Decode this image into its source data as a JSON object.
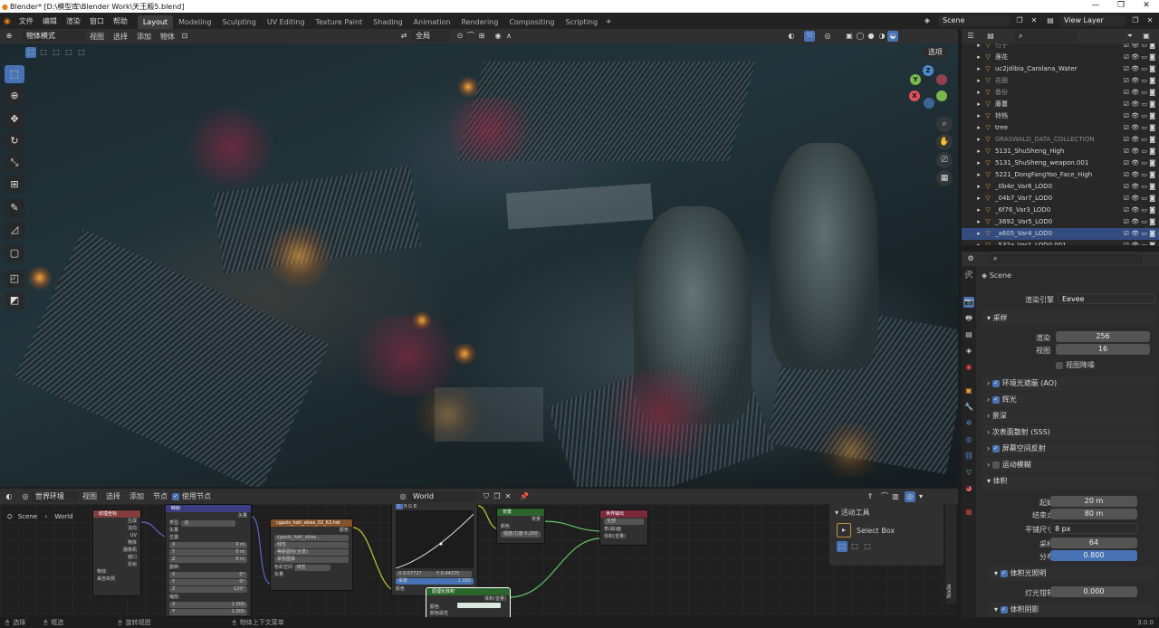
{
  "window": {
    "title": "Blender* [D:\\模型库\\Blender Work\\天王殿5.blend]",
    "minimize": "—",
    "restore": "❐",
    "close": "✕"
  },
  "menu": [
    "文件",
    "编辑",
    "渲染",
    "窗口",
    "帮助"
  ],
  "workspaces": [
    "Layout",
    "Modeling",
    "Sculpting",
    "UV Editing",
    "Texture Paint",
    "Shading",
    "Animation",
    "Rendering",
    "Compositing",
    "Scripting"
  ],
  "active_workspace": "Layout",
  "scene": {
    "name": "Scene",
    "view_layer": "View Layer"
  },
  "viewport_header": {
    "mode": "物体模式",
    "menus": [
      "视图",
      "选择",
      "添加",
      "物体"
    ],
    "transform": "全局",
    "options": "选项"
  },
  "toolbar": [
    "select-box",
    "cursor",
    "move",
    "rotate",
    "scale",
    "transform",
    "annotate",
    "measure",
    "add-cube"
  ],
  "gizmo": {
    "z": "Z",
    "y": "Y",
    "x": "X"
  },
  "node_header": {
    "type": "世界环境",
    "menus": [
      "视图",
      "选择",
      "添加",
      "节点"
    ],
    "use_nodes": "使用节点",
    "world": "World"
  },
  "node_breadcrumb": {
    "scene": "Scene",
    "world": "World"
  },
  "nodes": {
    "texcoord": {
      "title": "纹理坐标",
      "outputs": [
        "生成",
        "法向",
        "UV",
        "物体",
        "摄像机",
        "窗口",
        "反射"
      ],
      "object_label": "物体:",
      "from_instancer": "来自实例"
    },
    "mapping": {
      "title": "映射",
      "output": "矢量",
      "type_label": "类型:",
      "type_value": "点",
      "vector": "矢量",
      "location": "位置:",
      "x": "X",
      "y": "Y",
      "z": "Z",
      "loc_x": "0 m",
      "loc_y": "0 m",
      "loc_z": "0 m",
      "rotation": "旋转:",
      "rot_x": "0°",
      "rot_y": "0°",
      "rot_z": "120°",
      "scale": "缩放:",
      "sc_x": "1.000",
      "sc_y": "1.000"
    },
    "envtex": {
      "title": "cgaxis_hdri_skies_02_63.hdr",
      "output": "颜色",
      "image": "cgaxis_hdri_skies...",
      "interp": "线性",
      "proj": "等距圆柱(全景)",
      "ext": "单张图像",
      "colorspace_label": "色彩空间",
      "colorspace": "线性",
      "vector": "矢量"
    },
    "curves": {
      "x": "X 0.57727",
      "y": "Y 0.44375",
      "factor": "系数",
      "factor_val": "1.000",
      "color": "颜色"
    },
    "background": {
      "title": "背景",
      "output": "背景",
      "color": "颜色",
      "strength": "强度/力度",
      "strength_val": "0.200"
    },
    "world_output": {
      "title": "世界输出",
      "target": "全部",
      "surface": "表(曲)面",
      "volume": "体积(音量)"
    },
    "volume": {
      "title": "原理化体积",
      "output": "体积(音量)",
      "color": "颜色",
      "density": "颜色属性"
    }
  },
  "tool_panel": {
    "title": "活动工具",
    "tool": "Select Box",
    "tab": "Node"
  },
  "outliner": [
    {
      "name": "竹子",
      "dim": true
    },
    {
      "name": "莲花",
      "dim": false
    },
    {
      "name": "uc2jdibia_Carolana_Water",
      "dim": false
    },
    {
      "name": "花圈",
      "dim": true
    },
    {
      "name": "备份",
      "dim": true
    },
    {
      "name": "藤蔓",
      "dim": false
    },
    {
      "name": "铃铛",
      "dim": false
    },
    {
      "name": "tree",
      "dim": false
    },
    {
      "name": "GRASWALD_DATA_COLLECTION",
      "dim": true
    },
    {
      "name": "5131_ShuSheng_High",
      "dim": false
    },
    {
      "name": "5131_ShuSheng_weapon.001",
      "dim": false
    },
    {
      "name": "5221_DongFangYao_Face_High",
      "dim": false
    },
    {
      "name": "_0b4e_Var6_LOD0",
      "dim": false
    },
    {
      "name": "_04b7_Var7_LOD0",
      "dim": false
    },
    {
      "name": "_6f76_Var3_LOD0",
      "dim": false
    },
    {
      "name": "_3692_Var5_LOD0",
      "dim": false
    },
    {
      "name": "_a605_Var4_LOD0",
      "dim": false,
      "selected": true
    },
    {
      "name": "_532a_Var1_LOD0.001",
      "dim": false
    }
  ],
  "properties": {
    "scene": "Scene",
    "render_engine_label": "渲染引擎",
    "render_engine": "Eevee",
    "sampling": "采样",
    "render_label": "渲染",
    "render_samples": "256",
    "viewport_label": "视图",
    "viewport_samples": "16",
    "viewport_denoise": "视图降噪",
    "ao": "环境光遮蔽 (AO)",
    "bloom": "辉光",
    "dof": "景深",
    "sss": "次表面散射 (SSS)",
    "ssr": "屏幕空间反射",
    "motion_blur": "运动模糊",
    "volumetrics": "体积",
    "start_label": "起始",
    "start": "20 m",
    "end_label": "结束点",
    "end": "80 m",
    "tile_label": "平铺尺寸",
    "tile": "8 px",
    "samples_label": "采样",
    "samples": "64",
    "dist_label": "分布",
    "dist": "0.800",
    "vol_lighting": "体积光照明",
    "light_clamp_label": "灯光钳制",
    "light_clamp": "0.000",
    "vol_shadows": "体积阴影"
  },
  "statusbar": {
    "select": "选择",
    "box": "框选",
    "rotate": "旋转视图",
    "menu": "物体上下文菜单",
    "version": "3.0.0"
  }
}
